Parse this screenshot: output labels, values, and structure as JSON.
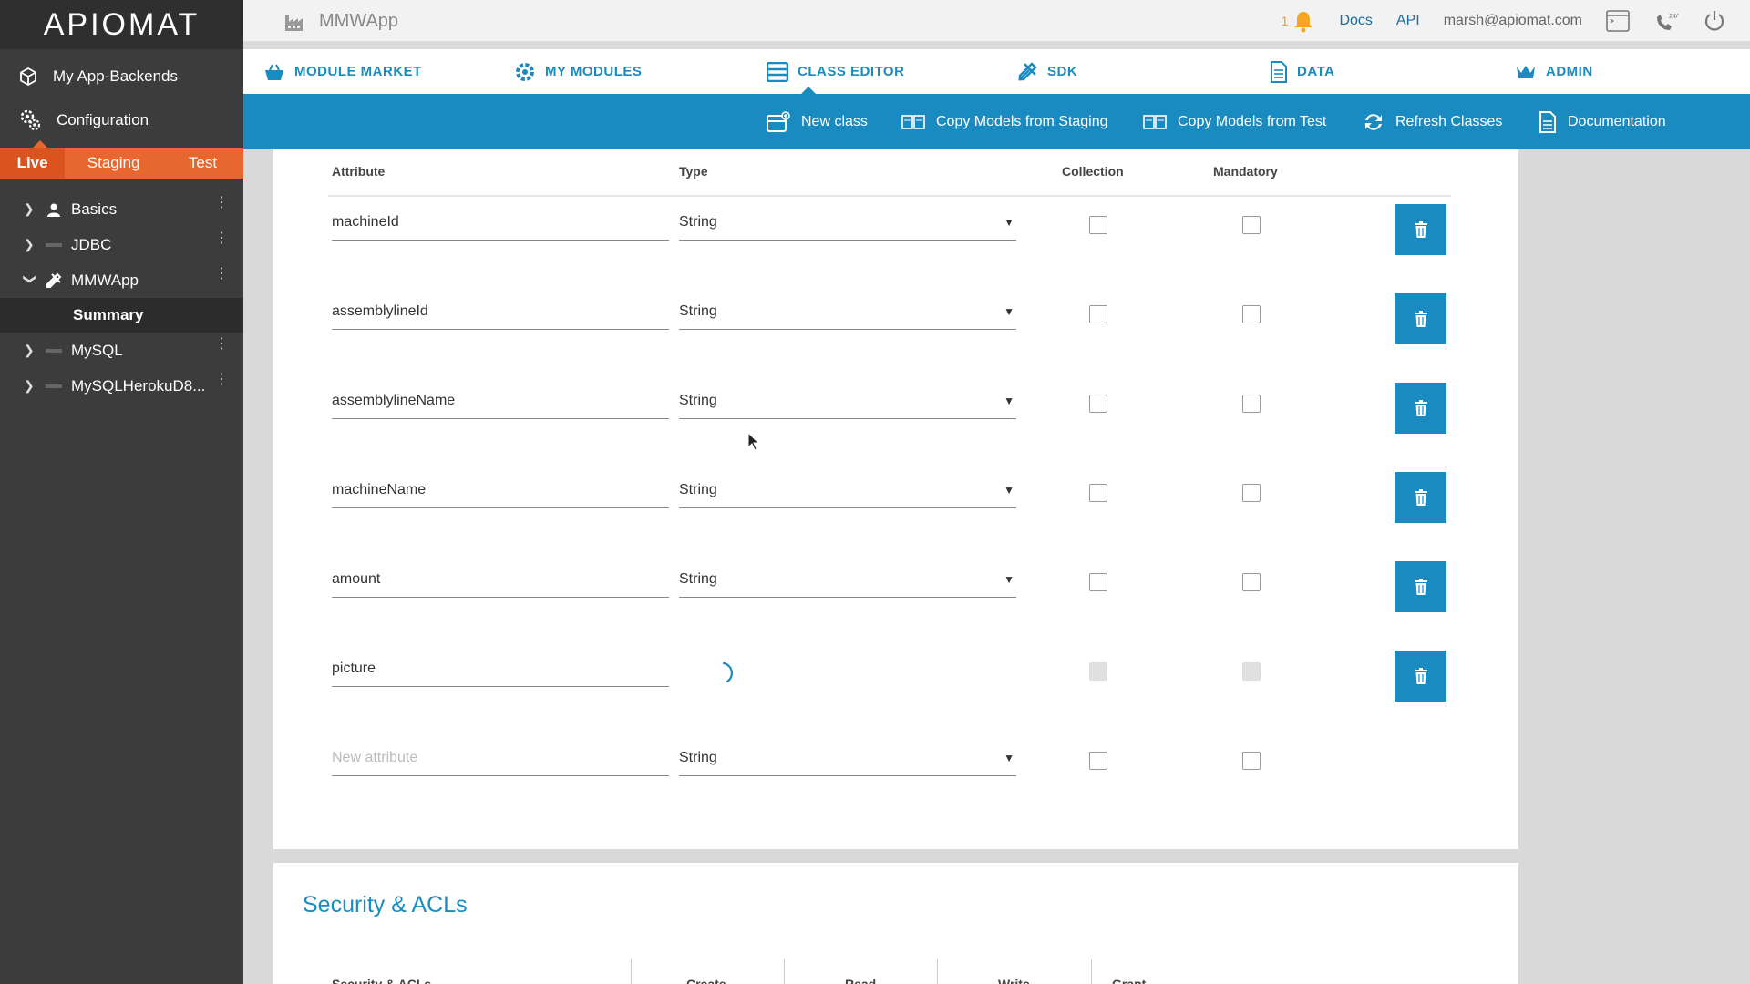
{
  "brand": {
    "logo_text": "APIOMAT"
  },
  "sidebar": {
    "nav": [
      {
        "label": "My App-Backends",
        "icon": "cube-icon"
      },
      {
        "label": "Configuration",
        "icon": "gears-icon"
      }
    ],
    "env_tabs": [
      "Live",
      "Staging",
      "Test"
    ],
    "active_env": "Live",
    "tree": [
      {
        "label": "Basics",
        "icon": "user-icon",
        "expanded": false
      },
      {
        "label": "JDBC",
        "icon": "jdbc-icon",
        "expanded": false
      },
      {
        "label": "MMWApp",
        "icon": "tools-icon",
        "expanded": true
      },
      {
        "label": "MySQL",
        "icon": "mysql-icon",
        "expanded": false
      },
      {
        "label": "MySQLHerokuD8...",
        "icon": "jdbc-icon",
        "expanded": false
      }
    ],
    "subitem": "Summary"
  },
  "topbar": {
    "app_name": "MMWApp",
    "notification_count": "1",
    "docs": "Docs",
    "api": "API",
    "email": "marsh@apiomat.com"
  },
  "modules": {
    "items": [
      "MODULE MARKET",
      "MY MODULES",
      "CLASS EDITOR",
      "SDK",
      "DATA",
      "ADMIN"
    ],
    "active": "CLASS EDITOR"
  },
  "toolbar": {
    "items": [
      "New class",
      "Copy Models from Staging",
      "Copy Models from Test",
      "Refresh Classes",
      "Documentation"
    ]
  },
  "attributes": {
    "headers": {
      "attribute": "Attribute",
      "type": "Type",
      "collection": "Collection",
      "mandatory": "Mandatory"
    },
    "rows": [
      {
        "name": "machineId",
        "type": "String",
        "loading": false
      },
      {
        "name": "assemblylineId",
        "type": "String",
        "loading": false
      },
      {
        "name": "assemblylineName",
        "type": "String",
        "loading": false
      },
      {
        "name": "machineName",
        "type": "String",
        "loading": false
      },
      {
        "name": "amount",
        "type": "String",
        "loading": false
      },
      {
        "name": "picture",
        "type": "",
        "loading": true
      }
    ],
    "new_attribute": {
      "placeholder": "New attribute",
      "type": "String"
    }
  },
  "security": {
    "title": "Security & ACLs",
    "headers": [
      "Security & ACLs",
      "Create",
      "Read",
      "Write",
      "Grant"
    ]
  },
  "colors": {
    "accent": "#1a8bc0",
    "orange": "#e8662f",
    "sidebar": "#3c3c3c"
  }
}
